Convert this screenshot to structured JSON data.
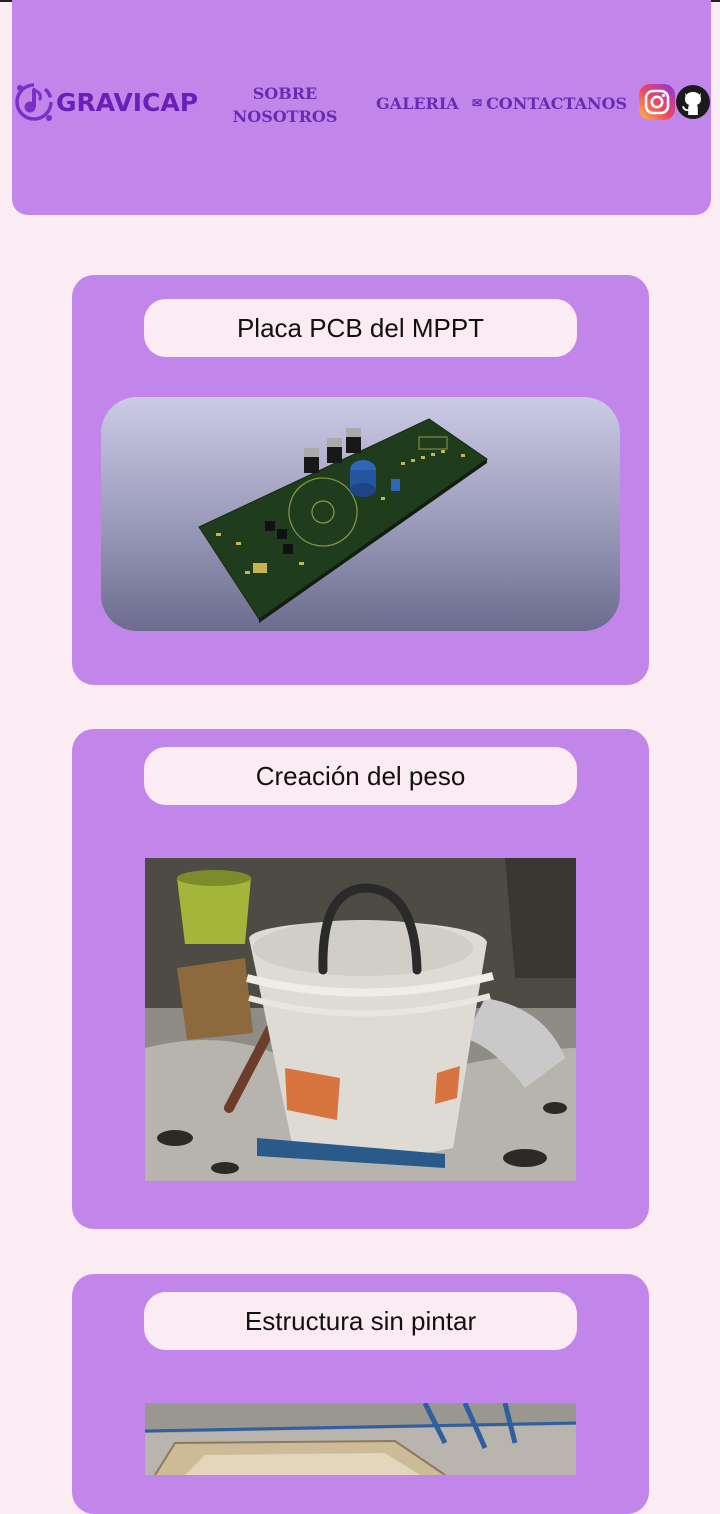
{
  "navbar": {
    "brand_name": "GRAVICAP",
    "logo_icon": "gravicap-logo-icon",
    "links": [
      {
        "label": "SOBRE NOSOTROS"
      },
      {
        "label": "GALERIA"
      },
      {
        "label": "CONTACTANOS",
        "icon": "envelope-icon"
      }
    ],
    "social": [
      {
        "icon": "instagram-icon"
      },
      {
        "icon": "github-icon"
      }
    ]
  },
  "gallery": [
    {
      "title": "Placa PCB del MPPT"
    },
    {
      "title": "Creación del peso"
    },
    {
      "title": "Estructura sin pintar"
    }
  ],
  "colors": {
    "background": "#fbecf4",
    "accent": "#c286ea",
    "brand_text": "#6a1fb8"
  }
}
